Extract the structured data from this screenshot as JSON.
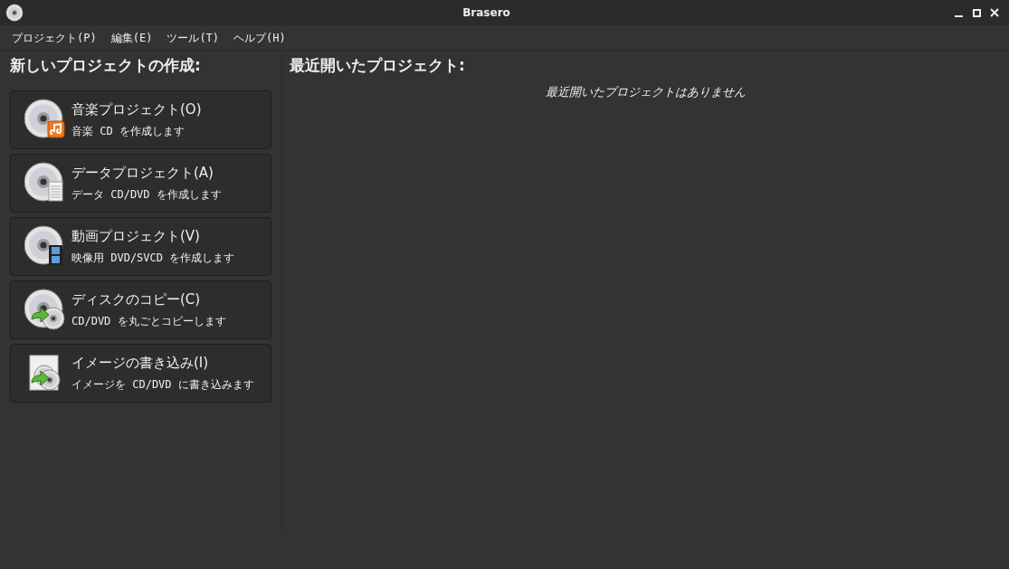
{
  "window": {
    "title": "Brasero"
  },
  "menu": [
    "プロジェクト(P)",
    "編集(E)",
    "ツール(T)",
    "ヘルプ(H)"
  ],
  "new_project": {
    "heading": "新しいプロジェクトの作成:",
    "items": [
      {
        "kind": "audio",
        "title": "音楽プロジェクト(O)",
        "description": "音楽 CD を作成します"
      },
      {
        "kind": "data",
        "title": "データプロジェクト(A)",
        "description": "データ CD/DVD を作成します"
      },
      {
        "kind": "video",
        "title": "動画プロジェクト(V)",
        "description": "映像用 DVD/SVCD を作成します"
      },
      {
        "kind": "copy",
        "title": "ディスクのコピー(C)",
        "description": "CD/DVD を丸ごとコピーします"
      },
      {
        "kind": "image",
        "title": "イメージの書き込み(I)",
        "description": "イメージを CD/DVD に書き込みます"
      }
    ]
  },
  "recent": {
    "heading": "最近開いたプロジェクト:",
    "empty_message": "最近開いたプロジェクトはありません"
  }
}
